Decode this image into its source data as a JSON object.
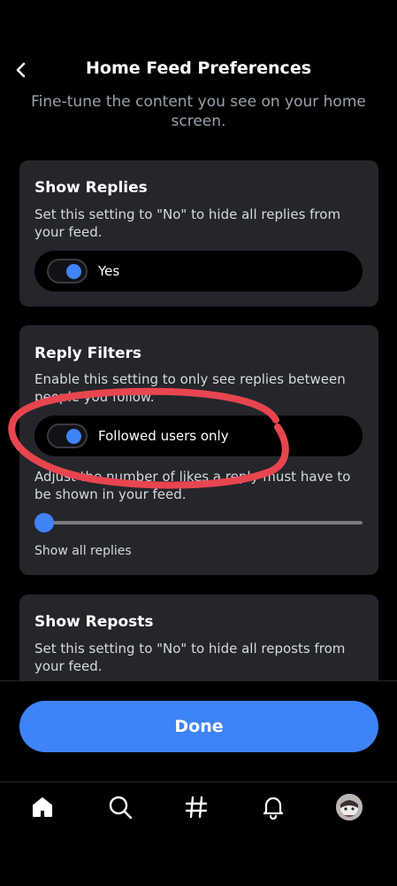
{
  "header": {
    "title": "Home Feed Preferences",
    "subtitle": "Fine-tune the content you see on your home screen."
  },
  "cards": {
    "show_replies": {
      "title": "Show Replies",
      "description": "Set this setting to \"No\" to hide all replies from your feed.",
      "toggle_label": "Yes",
      "toggle_on": true
    },
    "reply_filters": {
      "title": "Reply Filters",
      "description": "Enable this setting to only see replies between people you follow.",
      "toggle_label": "Followed users only",
      "toggle_on": true,
      "slider_description": "Adjust the number of likes a reply must have to be shown in your feed.",
      "slider_value": 0,
      "slider_caption": "Show all replies"
    },
    "show_reposts": {
      "title": "Show Reposts",
      "description": "Set this setting to \"No\" to hide all reposts from your feed."
    }
  },
  "footer": {
    "done_label": "Done"
  },
  "nav": {
    "items": [
      "home-icon",
      "search-icon",
      "hashtag-icon",
      "notifications-icon",
      "profile-avatar"
    ]
  },
  "colors": {
    "accent": "#3f83f8",
    "card_bg": "#25262c",
    "annotation": "#e8454f"
  }
}
